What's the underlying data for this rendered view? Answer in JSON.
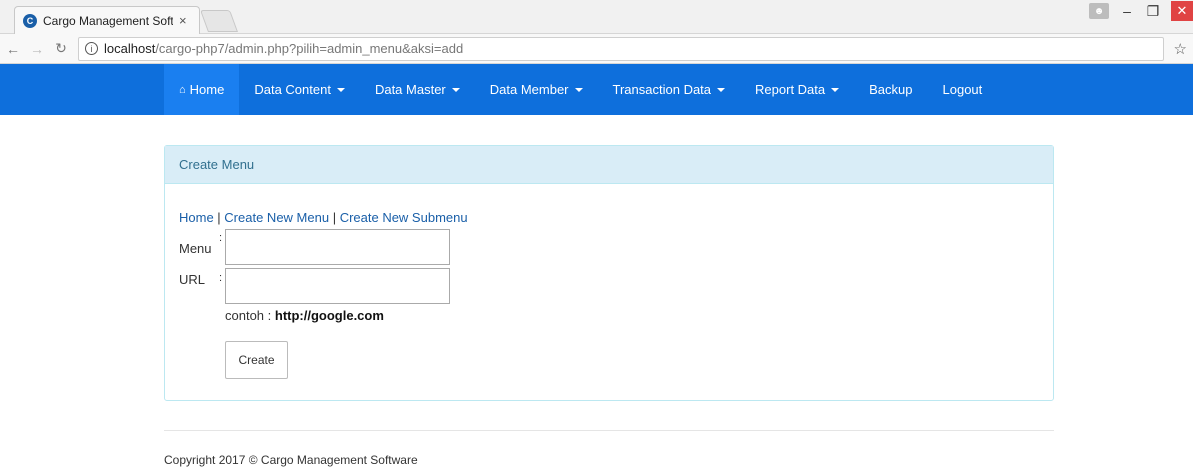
{
  "browser": {
    "tab_title": "Cargo Management Soft",
    "tab_close": "×",
    "favicon_letter": "C",
    "url_host": "localhost",
    "url_path": "/cargo-php7/admin.php?pilih=admin_menu&aksi=add",
    "icons": [
      "back-arrow-icon",
      "forward-arrow-icon",
      "reload-icon",
      "info-icon",
      "star-icon",
      "user-icon",
      "minimize-icon",
      "maximize-icon",
      "close-icon"
    ]
  },
  "navbar": {
    "color": "#0e6fdc",
    "items": [
      {
        "label": "Home",
        "active": true,
        "dropdown": false
      },
      {
        "label": "Data Content",
        "dropdown": true
      },
      {
        "label": "Data Master",
        "dropdown": true
      },
      {
        "label": "Data Member",
        "dropdown": true
      },
      {
        "label": "Transaction Data",
        "dropdown": true
      },
      {
        "label": "Report Data",
        "dropdown": true
      },
      {
        "label": "Backup",
        "dropdown": false
      },
      {
        "label": "Logout",
        "dropdown": false
      }
    ]
  },
  "panel": {
    "heading": "Create Menu",
    "links": {
      "home": "Home",
      "sep1": " | ",
      "create_menu": "Create New Menu",
      "sep2": " | ",
      "create_submenu": "Create New Submenu"
    },
    "form": {
      "menu_label": "Menu",
      "menu_value": "",
      "url_label": "URL",
      "url_value": "",
      "colon": ":",
      "hint_prefix": "contoh : ",
      "hint_example": "http://google.com",
      "submit_label": "Create"
    }
  },
  "footer": {
    "text": "Copyright 2017 © Cargo Management Software"
  }
}
